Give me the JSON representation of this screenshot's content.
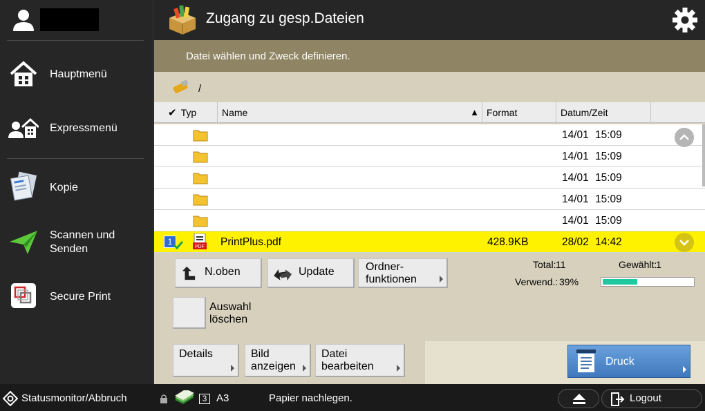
{
  "sidebar": {
    "items": [
      {
        "label": "Hauptmenü",
        "icon": "home-icon"
      },
      {
        "label": "Expressmenü",
        "icon": "express-menu-icon"
      },
      {
        "label": "Kopie",
        "icon": "copy-icon"
      },
      {
        "label": "Scannen und\nSenden",
        "icon": "scan-send-icon"
      },
      {
        "label": "Secure Print",
        "icon": "secure-print-icon"
      }
    ]
  },
  "header": {
    "title": "Zugang zu gesp.Dateien",
    "instruction": "Datei wählen und Zweck definieren."
  },
  "path": "/",
  "table": {
    "columns": [
      "Typ",
      "Name",
      "Format",
      "Datum/Zeit"
    ],
    "sort_indicator": "▲",
    "rows": [
      {
        "type": "folder",
        "name": "",
        "format": "",
        "date": "14/01",
        "time": "15:09"
      },
      {
        "type": "folder",
        "name": "",
        "format": "",
        "date": "14/01",
        "time": "15:09"
      },
      {
        "type": "folder",
        "name": "",
        "format": "",
        "date": "14/01",
        "time": "15:09"
      },
      {
        "type": "folder",
        "name": "",
        "format": "",
        "date": "14/01",
        "time": "15:09"
      },
      {
        "type": "folder",
        "name": "",
        "format": "",
        "date": "14/01",
        "time": "15:09"
      },
      {
        "type": "pdf",
        "name": "PrintPlus.pdf",
        "format": "428.9KB",
        "date": "28/02",
        "time": "14:42",
        "selected": true,
        "badge": "1"
      }
    ]
  },
  "actions": {
    "up": "N.oben",
    "update": "Update",
    "folder_functions": "Ordner-\nfunktionen",
    "total_label": "Total:",
    "total_value": "11",
    "selected_label": "Gewählt:",
    "selected_value": "1",
    "usage_label": "Verwend.:",
    "usage_value": "39%",
    "usage_fraction": 0.39,
    "clear_selection": "Auswahl\nlöschen"
  },
  "bottom": {
    "details": "Details",
    "view_image": "Bild\nanzeigen",
    "edit_file": "Datei\nbearbeiten",
    "print": "Druck"
  },
  "status": {
    "monitor": "Statusmonitor/Abbruch",
    "paper_count": "3",
    "paper_size": "A3",
    "message": "Papier nachlegen.",
    "logout": "Logout"
  },
  "colors": {
    "instruction_bar": "#8f8463",
    "selected_row": "#fff200",
    "print_button": "#4a85cc",
    "usage_fill": "#1fc9a0"
  }
}
